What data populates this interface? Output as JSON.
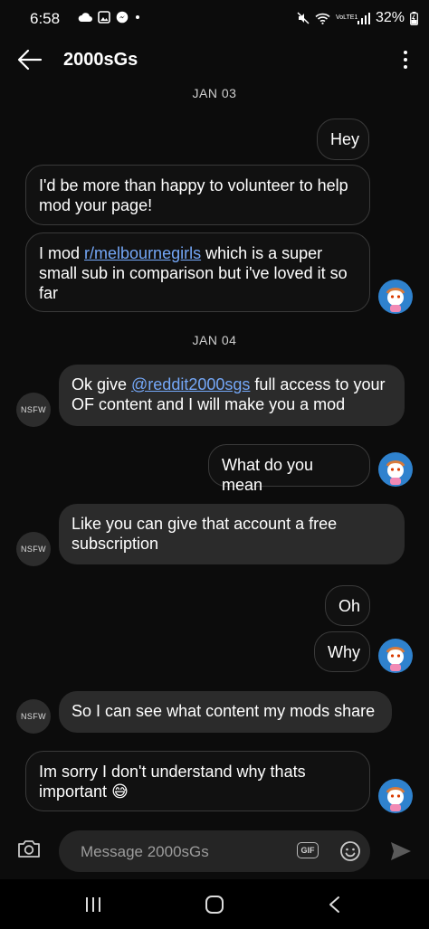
{
  "status_bar": {
    "time": "6:58",
    "network_label": "VoLTE1",
    "battery": "32%"
  },
  "header": {
    "title": "2000sGs"
  },
  "sections": [
    {
      "date": "JAN 03",
      "messages": [
        {
          "side": "sent",
          "text": "Hey"
        },
        {
          "side": "sent",
          "text": "I'd be more than happy to volunteer to help mod your page!"
        },
        {
          "side": "sent",
          "before": "I mod ",
          "link": "r/melbournegirls",
          "after": " which is a super small sub in comparison but i've loved it so far"
        }
      ]
    },
    {
      "date": "JAN 04",
      "messages": [
        {
          "side": "received",
          "before": "Ok give ",
          "link": "@reddit2000sgs",
          "after": " full access to your OF content and I will make you a mod",
          "avatar_label": "NSFW"
        },
        {
          "side": "sent",
          "text": "What do you mean"
        },
        {
          "side": "received",
          "text": "Like you can give that account a free subscription",
          "avatar_label": "NSFW"
        },
        {
          "side": "sent",
          "text": "Oh"
        },
        {
          "side": "sent",
          "text": "Why"
        },
        {
          "side": "received",
          "text": "So I can see what content my mods share",
          "avatar_label": "NSFW"
        },
        {
          "side": "sent",
          "text": "Im sorry I don't understand why thats important",
          "emoji": "😅"
        }
      ]
    }
  ],
  "composer": {
    "placeholder": "Message 2000sGs",
    "gif_label": "GIF"
  },
  "icons": [
    "back-arrow-icon",
    "overflow-menu-icon",
    "camera-icon",
    "emoji-icon",
    "send-icon",
    "recents-icon",
    "home-icon",
    "nav-back-icon"
  ],
  "colors": {
    "background": "#0c0c0c",
    "bubble": "#2b2b2b",
    "link": "#74a7f7",
    "avatar_user": "#2f82ce"
  }
}
